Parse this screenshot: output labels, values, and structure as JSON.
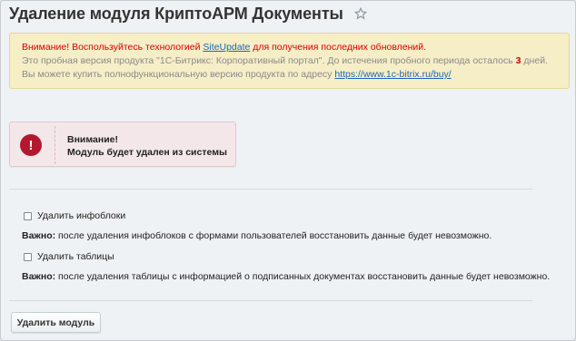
{
  "page": {
    "title": "Удаление модуля КриптоАРМ Документы"
  },
  "notice": {
    "warn_prefix": "Внимание! Воспользуйтесь технологией ",
    "link_siteupdate": "SiteUpdate",
    "warn_suffix": " для получения последних обновлений.",
    "trial_text_1": "Это пробная версия продукта \"1С-Битрикс: Корпоративный портал\". До истечения пробного периода осталось ",
    "days_left": "3",
    "trial_text_2": " дней. Вы можете купить полнофункциональную версию продукта по адресу ",
    "buy_link": "https://www.1c-bitrix.ru/buy/"
  },
  "alert": {
    "line1": "Внимание!",
    "line2": "Модуль будет удален из системы",
    "icon": "!"
  },
  "options": {
    "iblocks_label": "Удалить инфоблоки",
    "iblocks_hint_bold": "Важно:",
    "iblocks_hint": " после удаления инфоблоков с формами пользователей восстановить данные будет невозможно.",
    "tables_label": "Удалить таблицы",
    "tables_hint_bold": "Важно:",
    "tables_hint": " после удаления таблицы с информацией о подписанных документах восстановить данные будет невозможно."
  },
  "actions": {
    "delete_label": "Удалить модуль"
  },
  "colors": {
    "alert_icon": "#b3182e",
    "warning_text": "#d60000",
    "link": "#2067b0"
  }
}
